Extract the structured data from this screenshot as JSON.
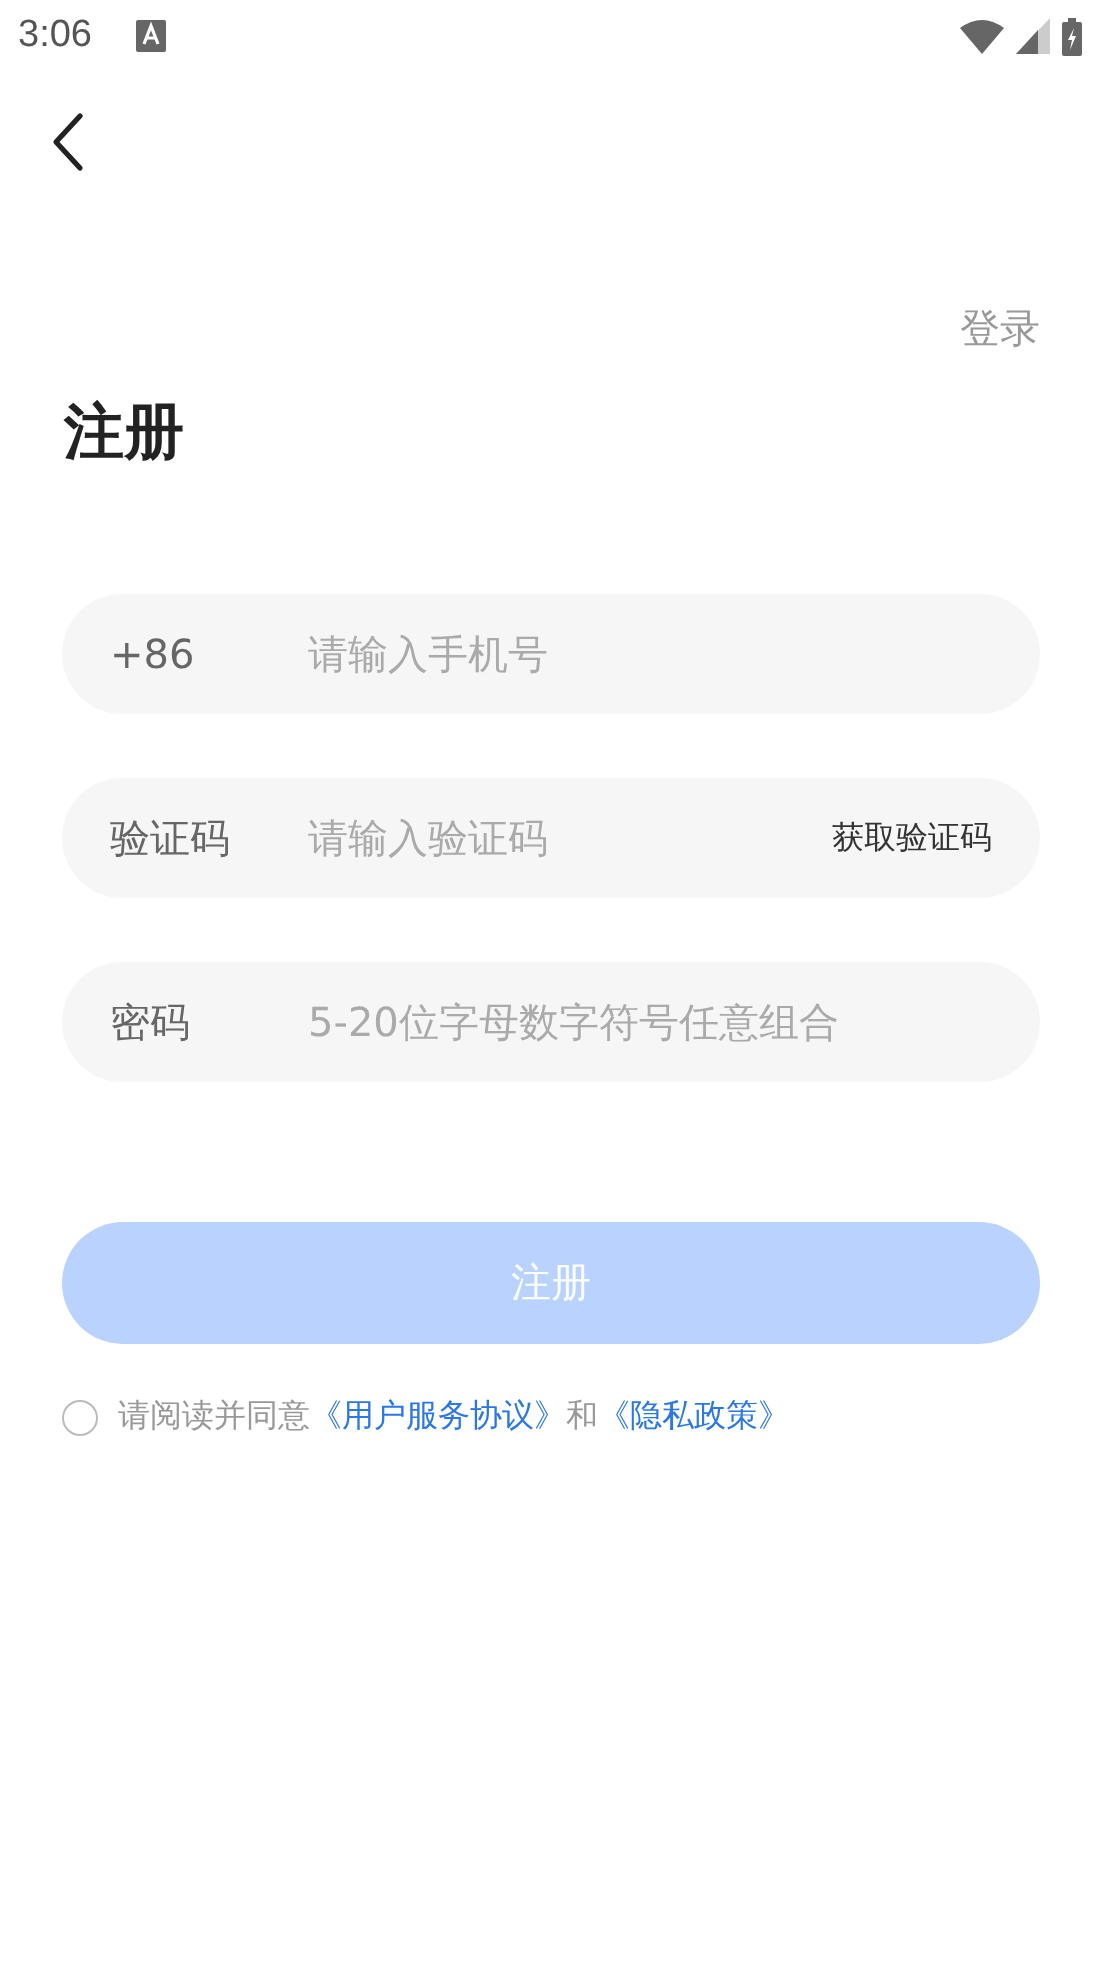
{
  "status_bar": {
    "time": "3:06"
  },
  "header": {
    "login_link": "登录"
  },
  "title": "注册",
  "fields": [
    {
      "label": "+86",
      "placeholder": "请输入手机号"
    },
    {
      "label": "验证码",
      "placeholder": "请输入验证码",
      "action": "获取验证码"
    },
    {
      "label": "密码",
      "placeholder": "5-20位字母数字符号任意组合"
    }
  ],
  "submit": {
    "label": "注册",
    "disabled": true
  },
  "agreement": {
    "checked": false,
    "parts": [
      {
        "kind": "text",
        "text": "请阅读并同意"
      },
      {
        "kind": "link",
        "text": "《用户服务协议》"
      },
      {
        "kind": "text",
        "text": "和"
      },
      {
        "kind": "link",
        "text": "《隐私政策》"
      }
    ]
  }
}
